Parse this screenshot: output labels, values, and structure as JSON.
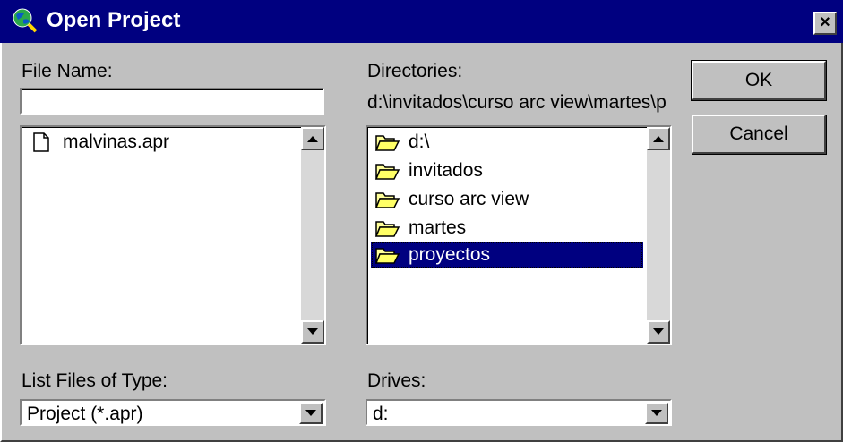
{
  "window": {
    "title": "Open Project",
    "close_glyph": "×"
  },
  "file_name": {
    "label": "File Name:",
    "value": ""
  },
  "files": [
    {
      "name": "malvinas.apr",
      "icon": "document-icon"
    }
  ],
  "directories": {
    "label": "Directories:",
    "path": "d:\\invitados\\curso arc view\\martes\\p",
    "items": [
      {
        "name": "d:\\",
        "icon": "open-folder-icon"
      },
      {
        "name": "invitados",
        "icon": "open-folder-icon"
      },
      {
        "name": "curso arc view",
        "icon": "open-folder-icon"
      },
      {
        "name": "martes",
        "icon": "open-folder-icon"
      },
      {
        "name": "proyectos",
        "icon": "open-folder-icon",
        "selected": true
      }
    ]
  },
  "buttons": {
    "ok": "OK",
    "cancel": "Cancel"
  },
  "file_type": {
    "label": "List Files of Type:",
    "value": "Project (*.apr)"
  },
  "drives": {
    "label": "Drives:",
    "value": "d:"
  },
  "colors": {
    "titlebar": "#000080",
    "face": "#c0c0c0",
    "selection": "#000080"
  }
}
